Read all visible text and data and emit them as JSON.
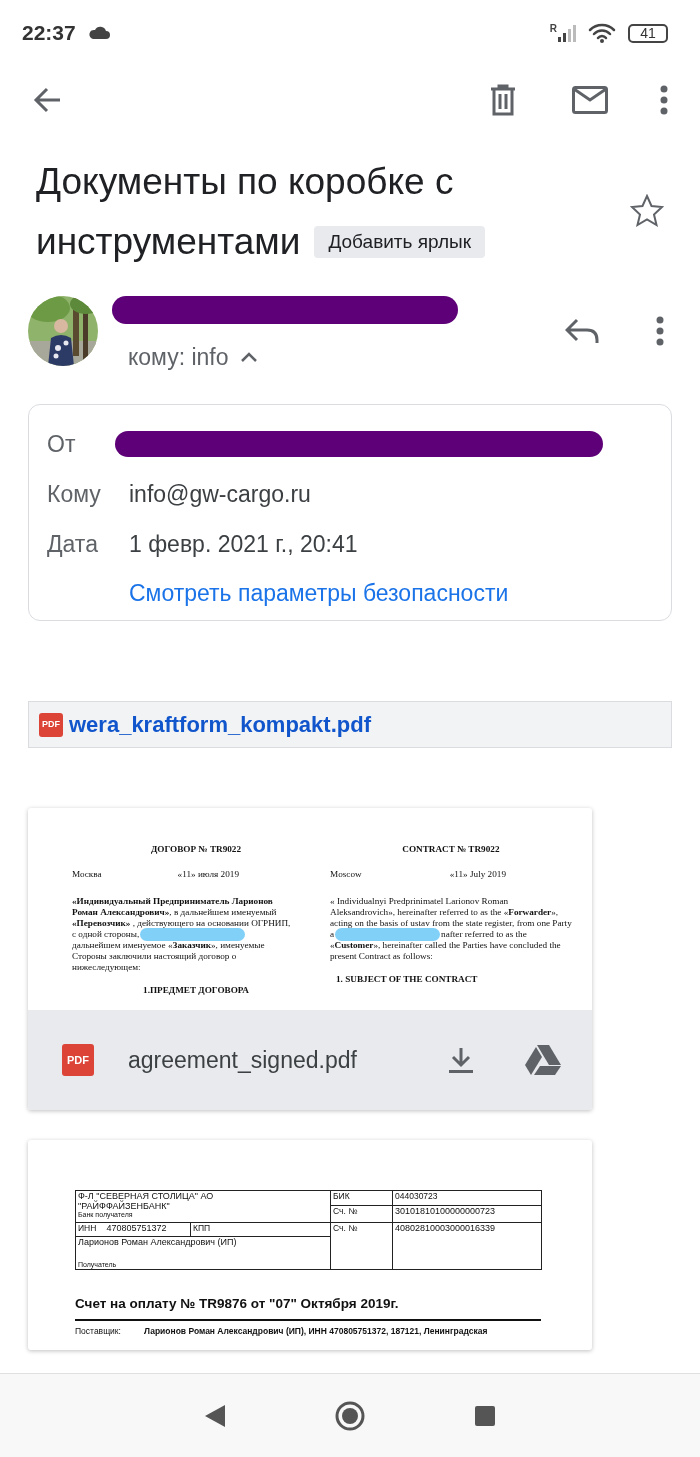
{
  "status_bar": {
    "time": "22:37",
    "battery": "41",
    "roaming": "R"
  },
  "subject": {
    "title": "Документы по коробке с инструментами",
    "label_chip": "Добавить ярлык",
    "starred": false
  },
  "sender": {
    "to_line": "кому: info",
    "expanded": true
  },
  "details": [
    {
      "label": "От",
      "redacted": true
    },
    {
      "label": "Кому",
      "value": "info@gw-cargo.ru",
      "redacted": false
    },
    {
      "label": "Дата",
      "value": "1 февр. 2021 г., 20:41",
      "redacted": false
    }
  ],
  "security_link": "Смотреть параметры безопасности",
  "link_attachment": {
    "badge": "PDF",
    "name": "wera_kraftform_kompakt.pdf"
  },
  "contract": {
    "badge": "PDF",
    "file_name": "agreement_signed.pdf",
    "ru": {
      "title": "ДОГОВОР № TR9022",
      "city": "Москва",
      "date": "«11» июля  2019",
      "lines": [
        [
          {
            "kind": "text",
            "text": "**«Индивидуальный Предприниматель Ларионов**"
          }
        ],
        [
          {
            "kind": "text",
            "text": "**Роман Александрович»**, в дальнейшем именуемый"
          }
        ],
        [
          {
            "kind": "text",
            "text": "**«Перевозчик»** , действующего на основании ОГРНИП,"
          }
        ],
        [
          {
            "kind": "text",
            "text": "с одной стороны,"
          },
          {
            "kind": "redaction"
          }
        ],
        [
          {
            "kind": "text",
            "text": "дальнейшем именуемое «**Заказчик**»,  именуемые"
          }
        ],
        [
          {
            "kind": "text",
            "text": "Стороны заключили настоящий договор о"
          }
        ],
        [
          {
            "kind": "text",
            "text": "нижеследующем:"
          }
        ]
      ],
      "section": "1.ПРЕДМЕТ ДОГОВОРА"
    },
    "en": {
      "title": "CONTRACT № TR9022",
      "city": "Moscow",
      "date": "«11» July  2019",
      "lines": [
        [
          {
            "kind": "text",
            "text": "« Individualnyi Predprinimatel Larionov Roman"
          }
        ],
        [
          {
            "kind": "text",
            "text": "Aleksandrovich», hereinafter referred to as the «**Forwarder**»,"
          }
        ],
        [
          {
            "kind": "text",
            "text": "acting on the basis  of  ustav from the state register, from one Party"
          }
        ],
        [
          {
            "kind": "text",
            "text": "a"
          },
          {
            "kind": "redaction"
          },
          {
            "kind": "text",
            "text": "nafter referred to as the"
          }
        ],
        [
          {
            "kind": "text",
            "text": "«**Customer**», hereinafter called the Parties have concluded the"
          }
        ],
        [
          {
            "kind": "text",
            "text": "present Contract as follows:"
          }
        ]
      ],
      "section": "1.   SUBJECT OF THE CONTRACT"
    }
  },
  "invoice": {
    "bank_lines": [
      "Ф-Л \"СЕВЕРНАЯ СТОЛИЦА\" АО",
      "\"РАЙФФАЙЗЕНБАНК\""
    ],
    "bank_caption": "Банк получателя",
    "bik_label": "БИК",
    "bik": "044030723",
    "corr_label": "Сч. №",
    "corr": "30101810100000000723",
    "inn_label": "ИНН",
    "inn": "470805751372",
    "kpp_label": "КПП",
    "acc_label": "Сч. №",
    "acc": "40802810003000016339",
    "recipient": "Ларионов Роман Александрович (ИП)",
    "recipient_caption": "Получатель",
    "title": "Счет на оплату № TR9876 от \"07\" Октября 2019г.",
    "supplier_label": "Поставщик:",
    "supplier": "Ларионов Роман Александрович (ИП), ИНН  470805751372, 187121, Ленинградская"
  }
}
